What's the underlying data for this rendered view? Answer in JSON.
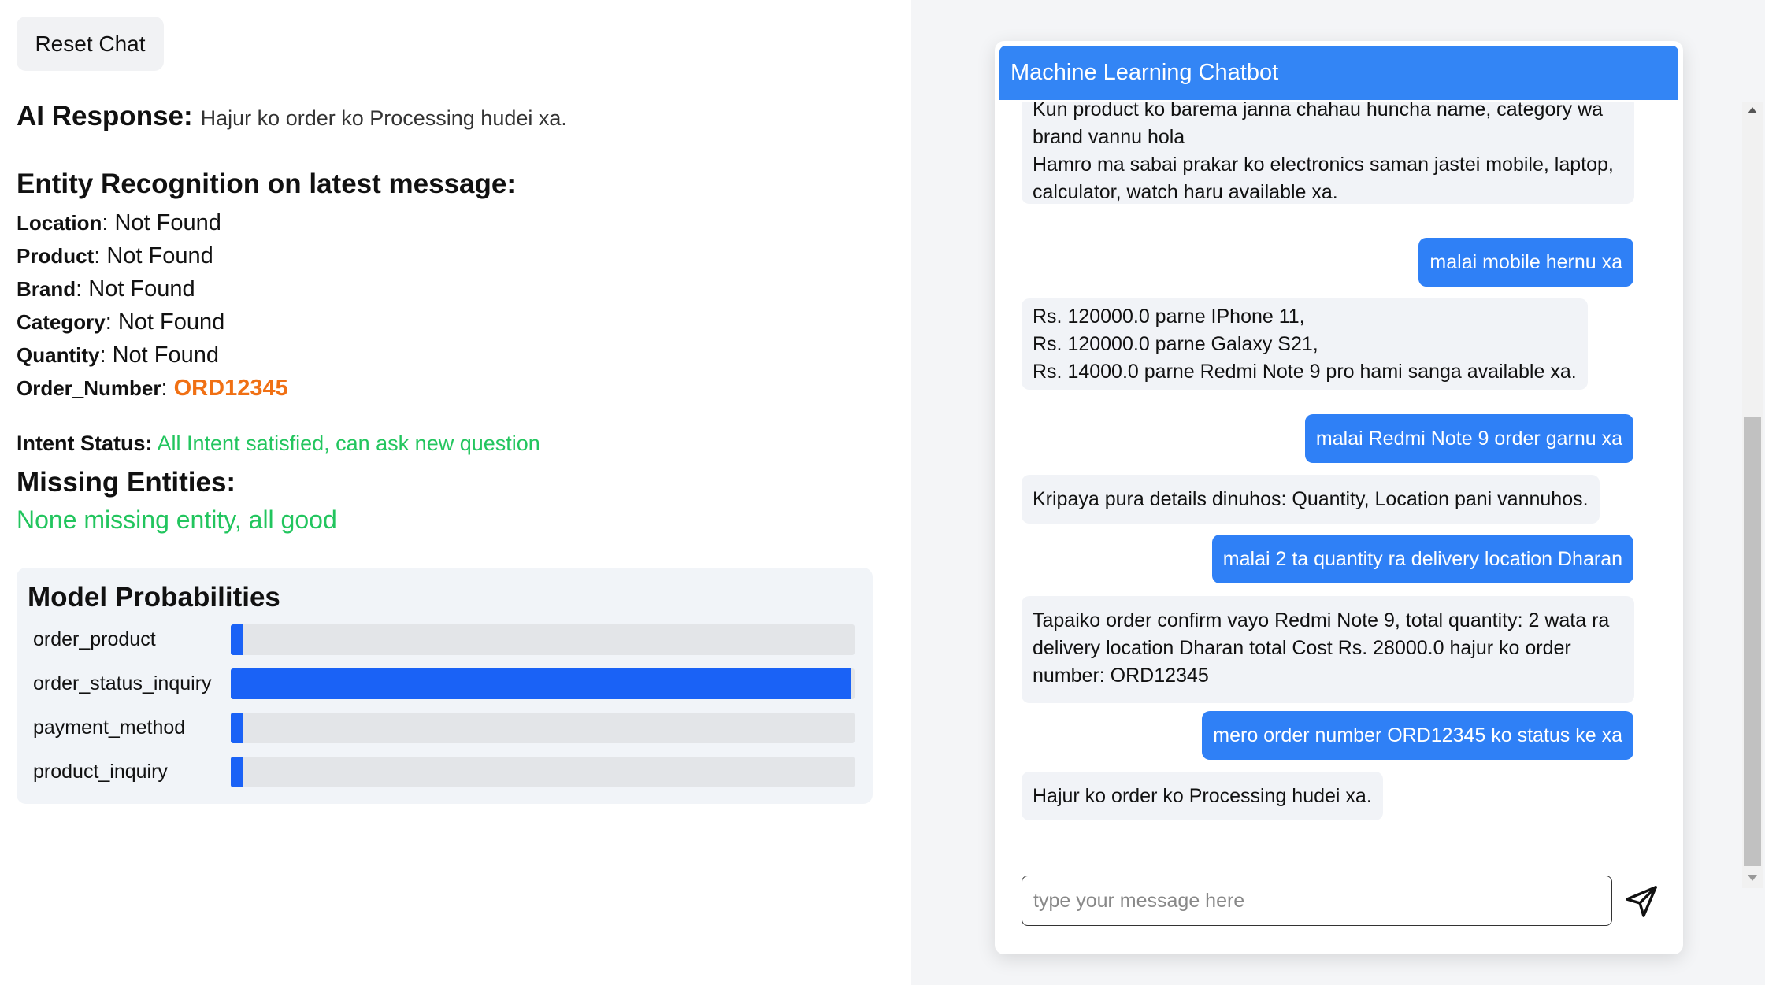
{
  "left": {
    "reset_label": "Reset Chat",
    "ai_response_label": "AI Response:",
    "ai_response_value": "Hajur ko order ko Processing hudei xa.",
    "entity_title": "Entity Recognition on latest message:",
    "entities": [
      {
        "key": "Location",
        "sep": ": ",
        "value": "Not Found"
      },
      {
        "key": "Product",
        "sep": ": ",
        "value": "Not Found"
      },
      {
        "key": "Brand",
        "sep": ": ",
        "value": "Not Found"
      },
      {
        "key": "Category",
        "sep": ": ",
        "value": "Not Found"
      },
      {
        "key": "Quantity",
        "sep": ": ",
        "value": "Not Found"
      },
      {
        "key": "Order_Number",
        "sep": ": ",
        "value": "ORD12345"
      }
    ],
    "intent_label": "Intent Status:",
    "intent_value": "All Intent satisfied, can ask new question",
    "missing_title": "Missing Entities:",
    "missing_value": "None missing entity, all good",
    "model_title": "Model Probabilities",
    "probabilities": [
      {
        "label": "order_product",
        "fraction": 0.002
      },
      {
        "label": "order_status_inquiry",
        "fraction": 0.995
      },
      {
        "label": "payment_method",
        "fraction": 0.0
      },
      {
        "label": "product_inquiry",
        "fraction": 0.003
      }
    ],
    "colors": {
      "found": "#f07014",
      "success": "#22c55e",
      "bar": "#1a62f6"
    }
  },
  "chat": {
    "title": "Machine Learning Chatbot",
    "messages": [
      {
        "role": "bot",
        "text": "Kun product ko barema janna chahau huncha name, category wa\nbrand vannu hola\nHamro ma sabai prakar ko electronics saman jastei mobile, laptop,\ncalculator, watch haru available xa."
      },
      {
        "role": "user",
        "text": "malai mobile hernu xa"
      },
      {
        "role": "bot",
        "text": "Rs. 120000.0 parne IPhone 11,\nRs. 120000.0 parne Galaxy S21,\nRs. 14000.0 parne Redmi Note 9 pro hami sanga available xa."
      },
      {
        "role": "user",
        "text": "malai Redmi Note 9 order garnu xa"
      },
      {
        "role": "bot",
        "text": "Kripaya pura details dinuhos: Quantity, Location pani vannuhos."
      },
      {
        "role": "user",
        "text": "malai 2 ta quantity ra delivery location Dharan"
      },
      {
        "role": "bot",
        "text": "Tapaiko order confirm vayo Redmi Note 9, total quantity:  2 wata ra\ndelivery location Dharan total Cost Rs. 28000.0 hajur ko order\nnumber: ORD12345"
      },
      {
        "role": "user",
        "text": "mero order number ORD12345 ko status ke xa"
      },
      {
        "role": "bot",
        "text": "Hajur ko order ko Processing hudei xa."
      }
    ],
    "input_placeholder": "type your message here",
    "input_value": "",
    "send_icon": "send-icon",
    "header_color": "#3385f5",
    "user_bubble_color": "#2f80f6"
  }
}
